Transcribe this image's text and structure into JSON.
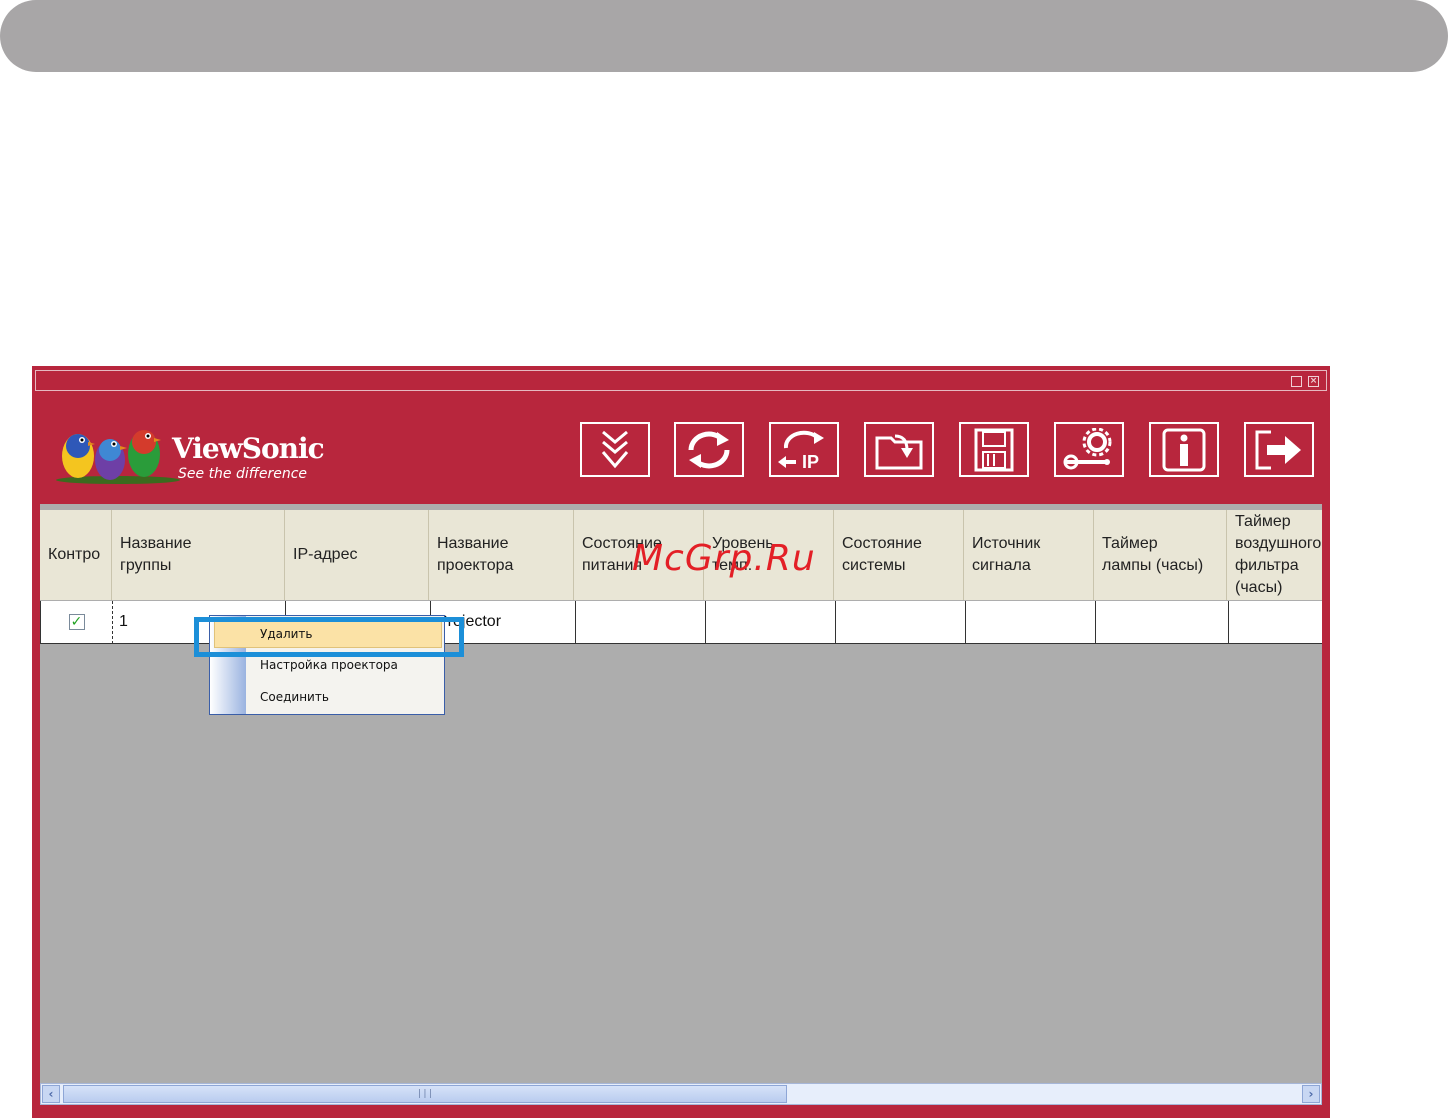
{
  "app": {
    "brand": "ViewSonic",
    "tagline": "See the difference"
  },
  "toolbar": {
    "icons": [
      "download-icon",
      "refresh-icon",
      "ip-change-icon",
      "folder-import-icon",
      "save-disk-icon",
      "settings-wrench-gear-icon",
      "info-icon",
      "exit-icon"
    ]
  },
  "table": {
    "headers": [
      "Контро",
      "Название\nгруппы",
      "IP-адрес",
      "Название\nпроектора",
      "Состояние\nпитания",
      "Уровень\nтемп.",
      "Состояние\nсистемы",
      "Источник\nсигнала",
      "Таймер\nлампы (часы)",
      "Таймер\nвоздушного\nфильтра\n(часы)"
    ],
    "rows": [
      {
        "checked": true,
        "group": "1",
        "ip": "",
        "projector": "Projector"
      }
    ]
  },
  "context_menu": {
    "items": [
      "Удалить",
      "Настройка проектора",
      "Соединить"
    ],
    "highlighted": "Удалить"
  },
  "watermark": "McGrp.Ru",
  "colors": {
    "window_bg": "#b8263d",
    "grid_bg": "#adadad",
    "header_bg": "#e9e6d6",
    "highlight": "#fbe2a6",
    "callout": "#1c8fd8",
    "banner": "#a8a6a7"
  }
}
